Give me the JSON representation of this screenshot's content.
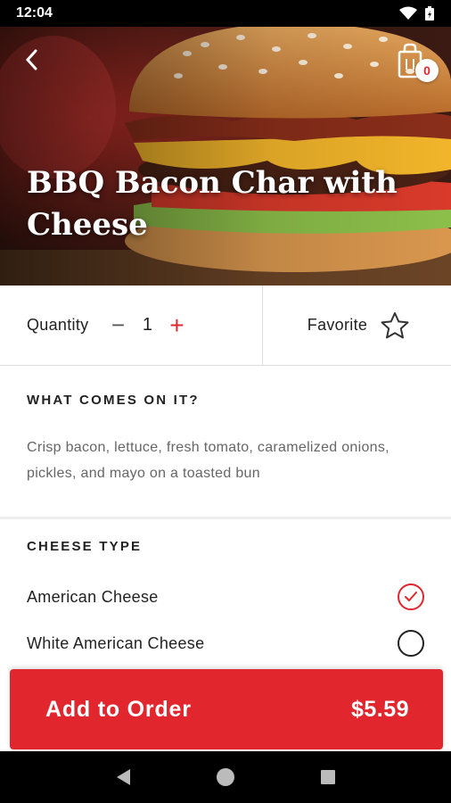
{
  "status": {
    "time": "12:04"
  },
  "header": {
    "title": "BBQ Bacon Char with Cheese",
    "cart_count": "0"
  },
  "quantity": {
    "label": "Quantity",
    "value": "1",
    "minus": "−",
    "plus": "+"
  },
  "favorite": {
    "label": "Favorite"
  },
  "ingredients": {
    "heading": "WHAT COMES ON IT?",
    "text": "Crisp bacon, lettuce, fresh tomato, caramelized onions, pickles, and mayo on a toasted bun"
  },
  "cheese": {
    "heading": "CHEESE TYPE",
    "options": [
      {
        "label": "American Cheese",
        "selected": true
      },
      {
        "label": "White American Cheese",
        "selected": false
      }
    ]
  },
  "order": {
    "label": "Add to Order",
    "price": "$5.59"
  },
  "colors": {
    "accent": "#e2262d",
    "text": "#222222",
    "muted": "#666666"
  }
}
